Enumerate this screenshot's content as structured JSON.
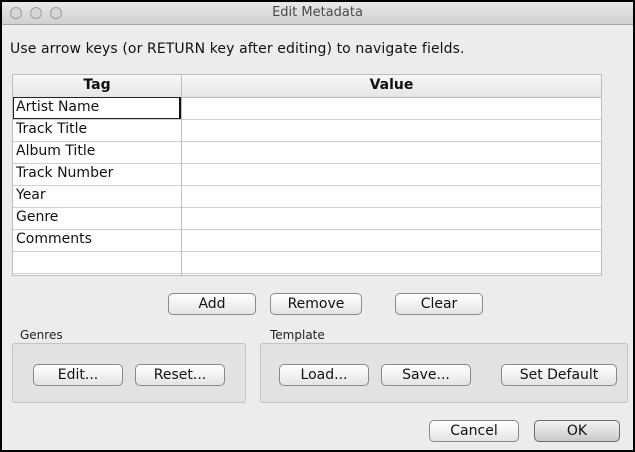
{
  "window": {
    "title": "Edit Metadata"
  },
  "instructions": "Use arrow keys (or RETURN key after editing) to navigate fields.",
  "table": {
    "headers": [
      "Tag",
      "Value"
    ],
    "rows": [
      {
        "tag": "Artist Name",
        "value": ""
      },
      {
        "tag": "Track Title",
        "value": ""
      },
      {
        "tag": "Album Title",
        "value": ""
      },
      {
        "tag": "Track Number",
        "value": ""
      },
      {
        "tag": "Year",
        "value": ""
      },
      {
        "tag": "Genre",
        "value": ""
      },
      {
        "tag": "Comments",
        "value": ""
      },
      {
        "tag": "",
        "value": ""
      }
    ]
  },
  "table_buttons": {
    "add": "Add",
    "remove": "Remove",
    "clear": "Clear"
  },
  "genres": {
    "label": "Genres",
    "edit": "Edit...",
    "reset": "Reset..."
  },
  "template": {
    "label": "Template",
    "load": "Load...",
    "save": "Save...",
    "set_default": "Set Default"
  },
  "dialog_buttons": {
    "cancel": "Cancel",
    "ok": "OK"
  }
}
